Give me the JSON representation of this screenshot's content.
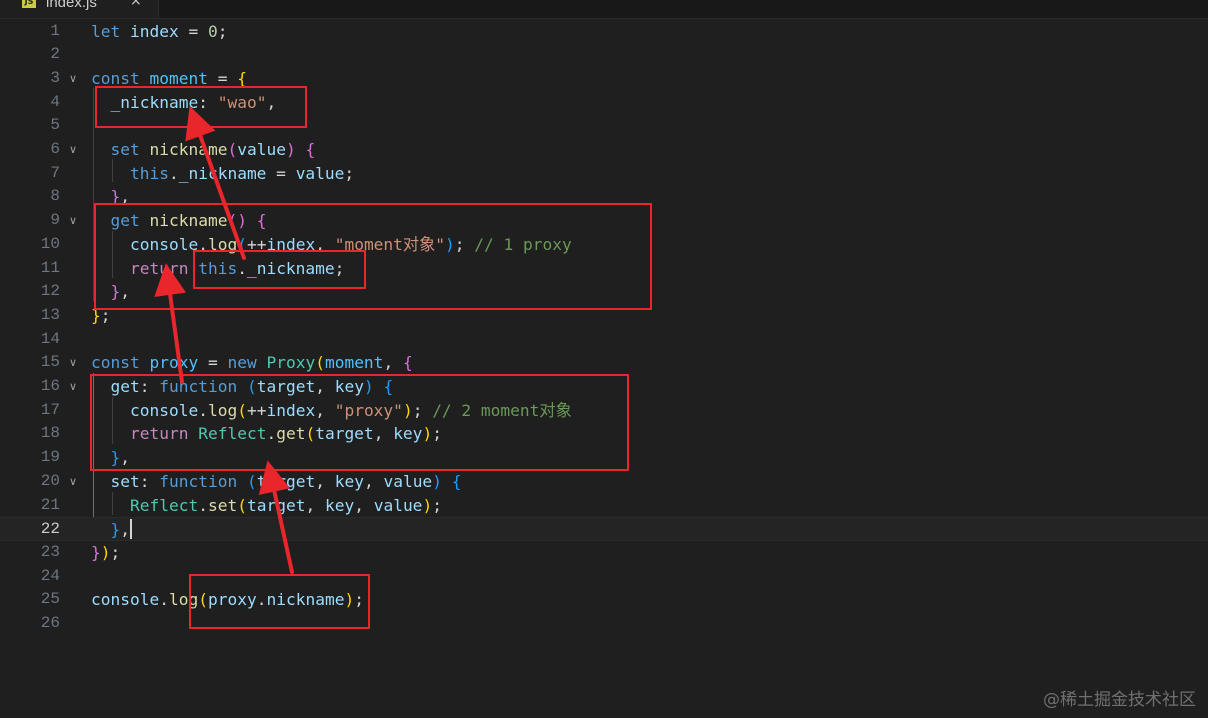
{
  "tab": {
    "icon": "JS",
    "filename": "index.js",
    "close": "×"
  },
  "lines": [
    {
      "num": "1",
      "tokens": [
        [
          "kw",
          "let"
        ],
        [
          "pl",
          " "
        ],
        [
          "var",
          "index"
        ],
        [
          "pl",
          " = "
        ],
        [
          "num",
          "0"
        ],
        [
          "pl",
          ";"
        ]
      ]
    },
    {
      "num": "2",
      "tokens": []
    },
    {
      "num": "3",
      "fold": true,
      "tokens": [
        [
          "kw",
          "const"
        ],
        [
          "pl",
          " "
        ],
        [
          "const",
          "moment"
        ],
        [
          "pl",
          " = "
        ],
        [
          "b1",
          "{"
        ]
      ]
    },
    {
      "num": "4",
      "tokens": [
        [
          "pl",
          "  "
        ],
        [
          "var",
          "_nickname"
        ],
        [
          "pl",
          ": "
        ],
        [
          "str",
          "\"wao\""
        ],
        [
          "pl",
          ","
        ]
      ]
    },
    {
      "num": "5",
      "tokens": []
    },
    {
      "num": "6",
      "fold": true,
      "tokens": [
        [
          "pl",
          "  "
        ],
        [
          "kw",
          "set"
        ],
        [
          "pl",
          " "
        ],
        [
          "fn",
          "nickname"
        ],
        [
          "b2",
          "("
        ],
        [
          "var",
          "value"
        ],
        [
          "b2",
          ")"
        ],
        [
          "pl",
          " "
        ],
        [
          "b2",
          "{"
        ]
      ]
    },
    {
      "num": "7",
      "tokens": [
        [
          "pl",
          "    "
        ],
        [
          "kw",
          "this"
        ],
        [
          "pl",
          "."
        ],
        [
          "var",
          "_nickname"
        ],
        [
          "pl",
          " = "
        ],
        [
          "var",
          "value"
        ],
        [
          "pl",
          ";"
        ]
      ]
    },
    {
      "num": "8",
      "tokens": [
        [
          "pl",
          "  "
        ],
        [
          "b2",
          "}"
        ],
        [
          "pl",
          ","
        ]
      ]
    },
    {
      "num": "9",
      "fold": true,
      "tokens": [
        [
          "pl",
          "  "
        ],
        [
          "kw",
          "get"
        ],
        [
          "pl",
          " "
        ],
        [
          "fn",
          "nickname"
        ],
        [
          "b2",
          "()"
        ],
        [
          "pl",
          " "
        ],
        [
          "b2",
          "{"
        ]
      ]
    },
    {
      "num": "10",
      "tokens": [
        [
          "pl",
          "    "
        ],
        [
          "var",
          "console"
        ],
        [
          "pl",
          "."
        ],
        [
          "fn",
          "log"
        ],
        [
          "b3",
          "("
        ],
        [
          "pl",
          "++"
        ],
        [
          "var",
          "index"
        ],
        [
          "pl",
          ", "
        ],
        [
          "str",
          "\"moment对象\""
        ],
        [
          "b3",
          ")"
        ],
        [
          "pl",
          "; "
        ],
        [
          "cm",
          "// 1 proxy"
        ]
      ]
    },
    {
      "num": "11",
      "tokens": [
        [
          "pl",
          "    "
        ],
        [
          "kwc",
          "return"
        ],
        [
          "pl",
          " "
        ],
        [
          "kw",
          "this"
        ],
        [
          "pl",
          "."
        ],
        [
          "var",
          "_nickname"
        ],
        [
          "pl",
          ";"
        ]
      ]
    },
    {
      "num": "12",
      "tokens": [
        [
          "pl",
          "  "
        ],
        [
          "b2",
          "}"
        ],
        [
          "pl",
          ","
        ]
      ]
    },
    {
      "num": "13",
      "tokens": [
        [
          "b1",
          "}"
        ],
        [
          "pl",
          ";"
        ]
      ]
    },
    {
      "num": "14",
      "tokens": []
    },
    {
      "num": "15",
      "fold": true,
      "tokens": [
        [
          "kw",
          "const"
        ],
        [
          "pl",
          " "
        ],
        [
          "const",
          "proxy"
        ],
        [
          "pl",
          " = "
        ],
        [
          "kw",
          "new"
        ],
        [
          "pl",
          " "
        ],
        [
          "cls",
          "Proxy"
        ],
        [
          "b1",
          "("
        ],
        [
          "const",
          "moment"
        ],
        [
          "pl",
          ", "
        ],
        [
          "b2",
          "{"
        ]
      ]
    },
    {
      "num": "16",
      "fold": true,
      "tokens": [
        [
          "pl",
          "  "
        ],
        [
          "var",
          "get"
        ],
        [
          "pl",
          ": "
        ],
        [
          "kw",
          "function"
        ],
        [
          "pl",
          " "
        ],
        [
          "b3",
          "("
        ],
        [
          "var",
          "target"
        ],
        [
          "pl",
          ", "
        ],
        [
          "var",
          "key"
        ],
        [
          "b3",
          ")"
        ],
        [
          "pl",
          " "
        ],
        [
          "b3",
          "{"
        ]
      ]
    },
    {
      "num": "17",
      "tokens": [
        [
          "pl",
          "    "
        ],
        [
          "var",
          "console"
        ],
        [
          "pl",
          "."
        ],
        [
          "fn",
          "log"
        ],
        [
          "b1",
          "("
        ],
        [
          "pl",
          "++"
        ],
        [
          "var",
          "index"
        ],
        [
          "pl",
          ", "
        ],
        [
          "str",
          "\"proxy\""
        ],
        [
          "b1",
          ")"
        ],
        [
          "pl",
          "; "
        ],
        [
          "cm",
          "// 2 moment对象"
        ]
      ]
    },
    {
      "num": "18",
      "tokens": [
        [
          "pl",
          "    "
        ],
        [
          "kwc",
          "return"
        ],
        [
          "pl",
          " "
        ],
        [
          "cls",
          "Reflect"
        ],
        [
          "pl",
          "."
        ],
        [
          "fn",
          "get"
        ],
        [
          "b1",
          "("
        ],
        [
          "var",
          "target"
        ],
        [
          "pl",
          ", "
        ],
        [
          "var",
          "key"
        ],
        [
          "b1",
          ")"
        ],
        [
          "pl",
          ";"
        ]
      ]
    },
    {
      "num": "19",
      "tokens": [
        [
          "pl",
          "  "
        ],
        [
          "b3",
          "}"
        ],
        [
          "pl",
          ","
        ]
      ]
    },
    {
      "num": "20",
      "fold": true,
      "tokens": [
        [
          "pl",
          "  "
        ],
        [
          "var",
          "set"
        ],
        [
          "pl",
          ": "
        ],
        [
          "kw",
          "function"
        ],
        [
          "pl",
          " "
        ],
        [
          "b3",
          "("
        ],
        [
          "var",
          "target"
        ],
        [
          "pl",
          ", "
        ],
        [
          "var",
          "key"
        ],
        [
          "pl",
          ", "
        ],
        [
          "var",
          "value"
        ],
        [
          "b3",
          ")"
        ],
        [
          "pl",
          " "
        ],
        [
          "b3",
          "{"
        ]
      ]
    },
    {
      "num": "21",
      "tokens": [
        [
          "pl",
          "    "
        ],
        [
          "cls",
          "Reflect"
        ],
        [
          "pl",
          "."
        ],
        [
          "fn",
          "set"
        ],
        [
          "b1",
          "("
        ],
        [
          "var",
          "target"
        ],
        [
          "pl",
          ", "
        ],
        [
          "var",
          "key"
        ],
        [
          "pl",
          ", "
        ],
        [
          "var",
          "value"
        ],
        [
          "b1",
          ")"
        ],
        [
          "pl",
          ";"
        ]
      ]
    },
    {
      "num": "22",
      "current": true,
      "tokens": [
        [
          "pl",
          "  "
        ],
        [
          "b3",
          "}"
        ],
        [
          "pl",
          ","
        ]
      ]
    },
    {
      "num": "23",
      "tokens": [
        [
          "b2",
          "}"
        ],
        [
          "b1",
          ")"
        ],
        [
          "pl",
          ";"
        ]
      ]
    },
    {
      "num": "24",
      "tokens": []
    },
    {
      "num": "25",
      "tokens": [
        [
          "var",
          "console"
        ],
        [
          "pl",
          "."
        ],
        [
          "fn",
          "log"
        ],
        [
          "b1",
          "("
        ],
        [
          "var",
          "proxy"
        ],
        [
          "pl",
          "."
        ],
        [
          "var",
          "nickname"
        ],
        [
          "b1",
          ")"
        ],
        [
          "pl",
          ";"
        ]
      ]
    },
    {
      "num": "26",
      "tokens": []
    }
  ],
  "colors": {
    "annotation": "#e8262c",
    "background": "#1f1f1f"
  },
  "watermark": "@稀土掘金技术社区"
}
